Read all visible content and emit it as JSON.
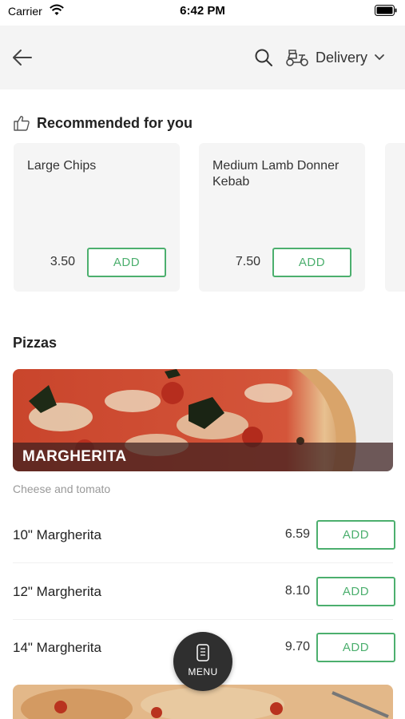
{
  "status_bar": {
    "carrier": "Carrier",
    "time": "6:42 PM"
  },
  "header": {
    "delivery_label": "Delivery",
    "icons": [
      "back-arrow-icon",
      "search-icon",
      "scooter-icon",
      "chevron-down-icon"
    ]
  },
  "recommended": {
    "title": "Recommended for you",
    "items": [
      {
        "name": "Large Chips",
        "price": "3.50",
        "add_label": "ADD"
      },
      {
        "name": "Medium Lamb Donner Kebab",
        "price": "7.50",
        "add_label": "ADD"
      }
    ]
  },
  "category": {
    "title": "Pizzas",
    "banner_label": "MARGHERITA",
    "description": "Cheese and tomato",
    "items": [
      {
        "name": "10\" Margherita",
        "price": "6.59",
        "add_label": "ADD"
      },
      {
        "name": "12\" Margherita",
        "price": "8.10",
        "add_label": "ADD"
      },
      {
        "name": "14\" Margherita",
        "price": "9.70",
        "add_label": "ADD"
      }
    ]
  },
  "menu_fab": {
    "label": "MENU"
  },
  "colors": {
    "accent_green": "#4caf6e",
    "header_bg": "#f4f4f4",
    "card_bg": "#f5f5f5",
    "fab_bg": "#2f2f2f"
  }
}
